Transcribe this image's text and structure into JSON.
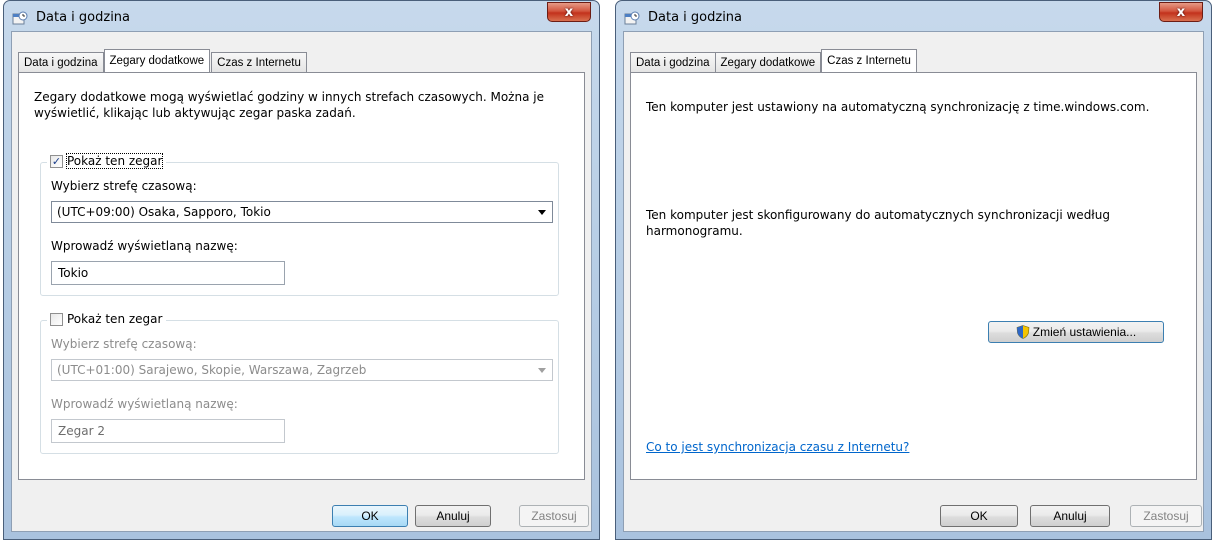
{
  "left_dialog": {
    "title": "Data i godzina",
    "close_label": "x",
    "tabs": [
      "Data i godzina",
      "Zegary dodatkowe",
      "Czas z Internetu"
    ],
    "active_tab": 1,
    "intro_line1": "Zegary dodatkowe mogą wyświetlać godziny w innych strefach czasowych. Można je",
    "intro_line2": "wyświetlić, klikając lub aktywując zegar paska zadań.",
    "clock1": {
      "checked": true,
      "check_mark": "✓",
      "show_label": "Pokaż ten zegar",
      "tz_label": "Wybierz strefę czasową:",
      "tz_value": "(UTC+09:00) Osaka, Sapporo, Tokio",
      "name_label": "Wprowadź wyświetlaną nazwę:",
      "name_value": "Tokio"
    },
    "clock2": {
      "checked": false,
      "show_label": "Pokaż ten zegar",
      "tz_label": "Wybierz strefę czasową:",
      "tz_value": "(UTC+01:00) Sarajewo, Skopie, Warszawa, Zagrzeb",
      "name_label": "Wprowadź wyświetlaną nazwę:",
      "name_value": "Zegar 2"
    },
    "buttons": {
      "ok": "OK",
      "cancel": "Anuluj",
      "apply": "Zastosuj"
    }
  },
  "right_dialog": {
    "title": "Data i godzina",
    "close_label": "x",
    "tabs": [
      "Data i godzina",
      "Zegary dodatkowe",
      "Czas z Internetu"
    ],
    "active_tab": 2,
    "sync_text": "Ten komputer jest ustawiony na automatyczną synchronizację z time.windows.com.",
    "schedule_line1": "Ten komputer jest skonfigurowany do automatycznych synchronizacji według",
    "schedule_line2": "harmonogramu.",
    "change_settings": "Zmień ustawienia...",
    "help_link": "Co to jest synchronizacja czasu z Internetu?",
    "buttons": {
      "ok": "OK",
      "cancel": "Anuluj",
      "apply": "Zastosuj"
    }
  },
  "colors": {
    "link": "#0066cc",
    "close_button": "#c3321c",
    "frame": "#b9cfe6"
  }
}
